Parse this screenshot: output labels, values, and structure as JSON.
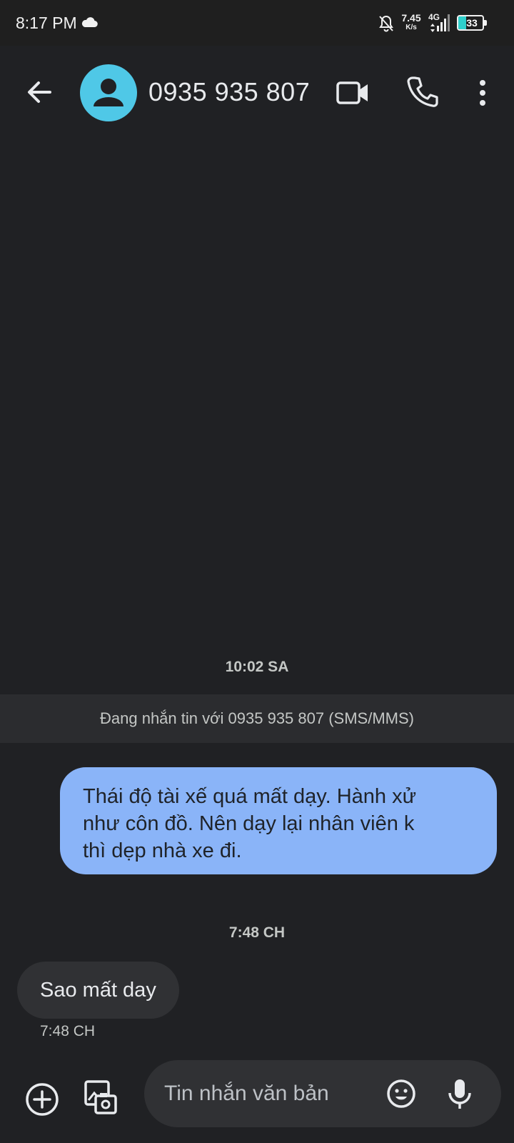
{
  "status_bar": {
    "time": "8:17 PM",
    "net_speed_value": "7.45",
    "net_speed_unit": "K/s",
    "network_type": "4G",
    "battery_level": "33",
    "battery_fraction": 0.33,
    "icons": [
      "cloud-icon",
      "bell-off-icon",
      "signal-icon",
      "battery-icon"
    ]
  },
  "header": {
    "contact": "0935 935 807",
    "avatar_color": "#4fc8e7",
    "icons": [
      "back-arrow-icon",
      "person-icon",
      "video-camera-icon",
      "phone-icon",
      "more-vert-icon"
    ]
  },
  "conversation": {
    "first_timestamp": "10:02 SA",
    "banner": "Đang nhắn tin với 0935 935 807 (SMS/MMS)",
    "outgoing": {
      "lines": [
        "Thái độ tài xế quá mất dạy. Hành xử",
        "như côn đồ. Nên dạy lại nhân viên k",
        "thì dẹp nhà xe đi."
      ],
      "color": "#8ab4f8"
    },
    "second_timestamp": "7:48 CH",
    "incoming": {
      "text": "Sao mất day",
      "time": "7:48 CH",
      "color": "#303134"
    }
  },
  "compose": {
    "placeholder": "Tin nhắn văn bản",
    "icons": [
      "add-circle-icon",
      "gallery-camera-icon",
      "emoji-icon",
      "mic-icon"
    ]
  }
}
